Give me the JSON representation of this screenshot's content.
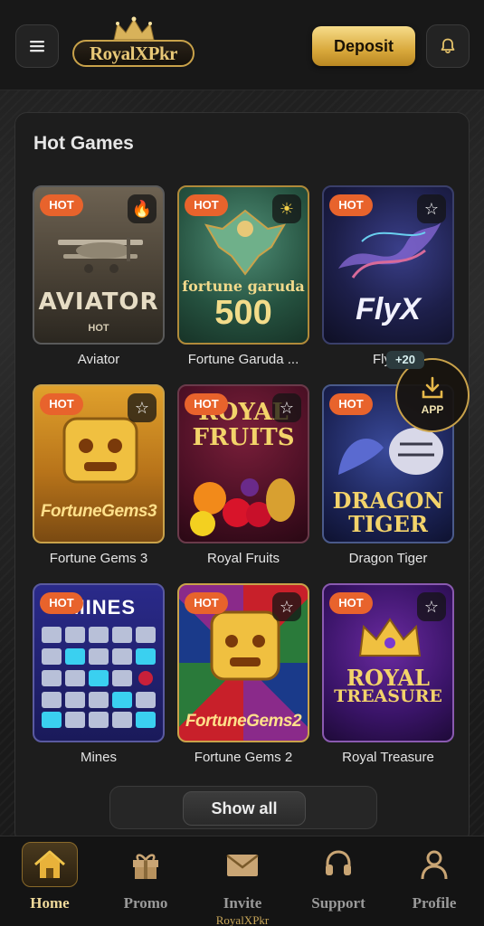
{
  "header": {
    "logo_text": "RoyalXPkr",
    "deposit_label": "Deposit",
    "menu_icon": "hamburger-icon",
    "bell_icon": "bell-icon"
  },
  "section": {
    "title": "Hot Games"
  },
  "games": [
    {
      "name": "Aviator",
      "badge": "HOT",
      "fav_icon": "flame-icon",
      "art_title": "AVIATOR",
      "art_sub": "HOT"
    },
    {
      "name": "Fortune Garuda ...",
      "badge": "HOT",
      "fav_icon": "sun-icon",
      "art_title": "fortune garuda",
      "art_sub": "500"
    },
    {
      "name": "Fly",
      "badge": "HOT",
      "fav_icon": "star-icon",
      "art_title": "FlyX",
      "art_sub": ""
    },
    {
      "name": "Fortune Gems 3",
      "badge": "HOT",
      "fav_icon": "star-icon",
      "art_title": "FortuneGems3",
      "art_sub": ""
    },
    {
      "name": "Royal Fruits",
      "badge": "HOT",
      "fav_icon": "star-icon",
      "art_title": "ROYAL",
      "art_sub": "FRUITS"
    },
    {
      "name": "Dragon Tiger",
      "badge": "HOT",
      "fav_icon": "star-icon",
      "art_title": "DRAGON",
      "art_sub": "TIGER"
    },
    {
      "name": "Mines",
      "badge": "HOT",
      "fav_icon": "star-icon",
      "art_title": "MINES",
      "art_sub": ""
    },
    {
      "name": "Fortune Gems 2",
      "badge": "HOT",
      "fav_icon": "star-icon",
      "art_title": "FortuneGems2",
      "art_sub": ""
    },
    {
      "name": "Royal Treasure",
      "badge": "HOT",
      "fav_icon": "star-icon",
      "art_title": "ROYAL",
      "art_sub": "TREASURE"
    }
  ],
  "show_all_label": "Show all",
  "app_badge": {
    "count": "+20",
    "label": "APP"
  },
  "nav": [
    {
      "label": "Home",
      "icon": "home-icon",
      "active": true
    },
    {
      "label": "Promo",
      "icon": "gift-icon",
      "active": false
    },
    {
      "label": "Invite",
      "icon": "envelope-icon",
      "active": false
    },
    {
      "label": "Support",
      "icon": "headset-icon",
      "active": false
    },
    {
      "label": "Profile",
      "icon": "user-icon",
      "active": false
    }
  ],
  "footer_logo_text": "RoyalXPkr",
  "colors": {
    "accent_gold": "#d9a93c",
    "hot_badge": "#e8632c"
  }
}
